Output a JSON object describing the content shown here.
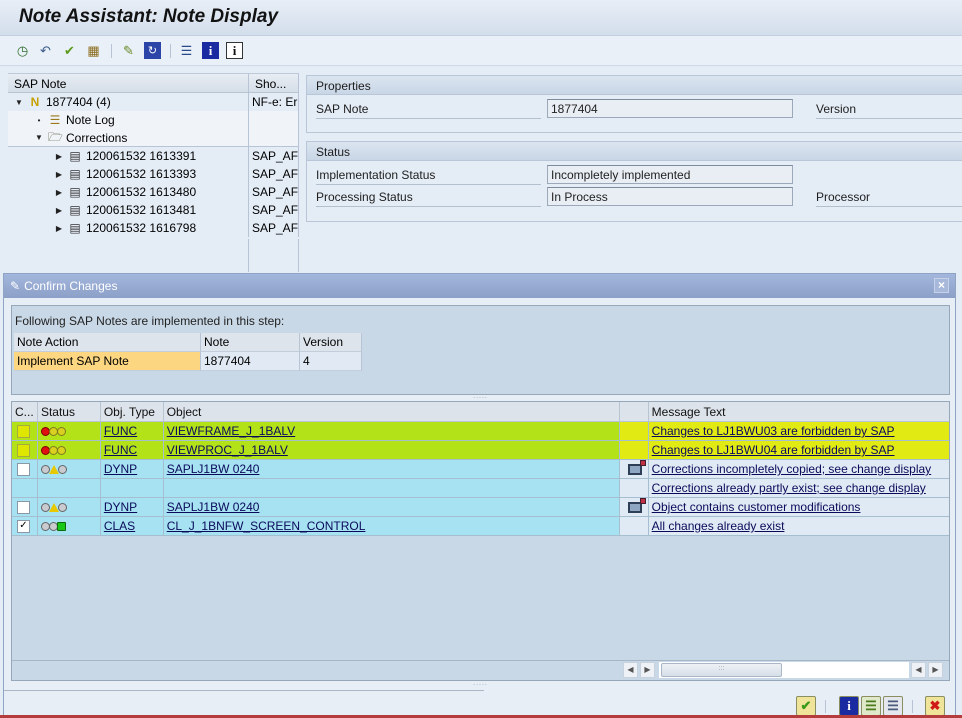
{
  "window": {
    "title": "Note Assistant: Note Display"
  },
  "toolbar": {
    "icons": [
      "clock-check-icon",
      "undo-icon",
      "check-pencil-icon",
      "hierarchy-icon",
      "edit-icon",
      "refresh-icon",
      "list-icon",
      "info-icon",
      "info-outline-icon"
    ]
  },
  "tree": {
    "headers": [
      "SAP Note",
      "Sho..."
    ],
    "root": {
      "label": "1877404 (4)",
      "short": "NF-e: Er"
    },
    "note_log": "Note Log",
    "corrections": "Corrections",
    "items": [
      {
        "label": "120061532 1613391",
        "short": "SAP_AF"
      },
      {
        "label": "120061532 1613393",
        "short": "SAP_AF"
      },
      {
        "label": "120061532 1613480",
        "short": "SAP_AF"
      },
      {
        "label": "120061532 1613481",
        "short": "SAP_AF"
      },
      {
        "label": "120061532 1616798",
        "short": "SAP_AF"
      }
    ]
  },
  "properties": {
    "title": "Properties",
    "sap_note_label": "SAP Note",
    "sap_note_value": "1877404",
    "version_label": "Version"
  },
  "status": {
    "title": "Status",
    "impl_label": "Implementation Status",
    "impl_value": "Incompletely implemented",
    "proc_label": "Processing Status",
    "proc_value": "In Process",
    "processor_label": "Processor"
  },
  "dialog": {
    "title": "Confirm Changes",
    "caption": "Following SAP Notes are implemented in this step:",
    "notes_headers": [
      "Note Action",
      "Note",
      "Version"
    ],
    "notes_rows": [
      {
        "action": "Implement SAP Note",
        "note": "1877404",
        "version": "4"
      }
    ],
    "grid_headers": [
      "C...",
      "Status",
      "Obj. Type",
      "Object",
      "",
      "Message Text"
    ],
    "grid_rows": [
      {
        "checked": false,
        "lights": "red",
        "type": "FUNC",
        "object": "VIEWFRAME_J_1BALV",
        "icon": false,
        "message": "Changes to LJ1BWU03 are forbidden by SAP",
        "highlight": true
      },
      {
        "checked": false,
        "lights": "red",
        "type": "FUNC",
        "object": "VIEWPROC_J_1BALV",
        "icon": false,
        "message": "Changes to LJ1BWU04 are forbidden by SAP",
        "highlight": true
      },
      {
        "checked": false,
        "lights": "yellow",
        "type": "DYNP",
        "object": "SAPLJ1BW 0240",
        "icon": true,
        "message": "Corrections incompletely copied; see change display",
        "highlight": false
      },
      {
        "checked": null,
        "lights": null,
        "type": "",
        "object": "",
        "icon": false,
        "message": "Corrections already partly exist; see change display",
        "highlight": false
      },
      {
        "checked": false,
        "lights": "yellow",
        "type": "DYNP",
        "object": "SAPLJ1BW 0240",
        "icon": true,
        "message": "Object contains customer modifications",
        "highlight": false
      },
      {
        "checked": true,
        "lights": "green",
        "type": "CLAS",
        "object": "CL_J_1BNFW_SCREEN_CONTROL",
        "icon": false,
        "message": "All changes already exist",
        "highlight": false
      }
    ],
    "footer_buttons": [
      "confirm-icon",
      "info-icon",
      "select-all-icon",
      "deselect-all-icon",
      "cancel-icon"
    ]
  },
  "colors": {
    "highlight_green": "#b4e219",
    "highlight_yellow": "#e2ea14",
    "row_cyan": "#a6e2f2",
    "dialog_title": "#8ca0c8"
  }
}
